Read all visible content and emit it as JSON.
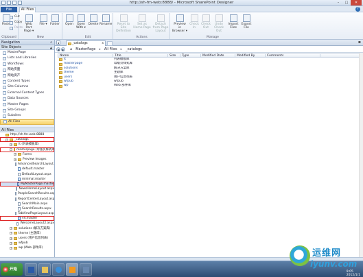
{
  "window": {
    "title": "http://sh-fm-web:8888/ - Microsoft SharePoint Designer",
    "controls": [
      "–",
      "□",
      "✕"
    ]
  },
  "menu": {
    "file": "File",
    "tab": "All Files",
    "help": "?"
  },
  "ribbon": {
    "clipboard": {
      "label": "Clipboard",
      "paste": "Paste",
      "cut": "Cut",
      "copy": "Copy",
      "paste_small": "Paste"
    },
    "new": {
      "label": "New",
      "web_part_page": "Web Part Page ▾",
      "file": "File ▾",
      "folder": "Folder"
    },
    "edit": {
      "label": "Edit",
      "open": "Open",
      "open_with": "Open With ▾",
      "delete": "Delete",
      "rename": "Rename"
    },
    "actions": {
      "label": "Actions",
      "reset": "Reset to Site Definition",
      "set_home": "Set as Home Page",
      "detach": "Detach from Page Layout"
    },
    "manage": {
      "label": "Manage",
      "preview": "Preview in Browser ▾",
      "check_in": "Check In",
      "check_out": "Check Out",
      "undo_checkout": "Undo Check Out",
      "import": "Import Files",
      "export": "Export File"
    }
  },
  "nav": {
    "title": "Navigation",
    "site_objects_header": "Site Objects",
    "site_objects": [
      "MasterPage",
      "Lists and Libraries",
      "Workflows",
      "网站页面",
      "网站资产",
      "Content Types",
      "Site Columns",
      "External Content Types",
      "Data Sources",
      "Master Pages",
      "Site Groups",
      "Subsites",
      "All Files"
    ],
    "all_files_header": "All Files",
    "tree": [
      {
        "label": "http://sh-fm-web:8888",
        "indent": 0,
        "type": "site",
        "exp": ""
      },
      {
        "label": "_catalogs",
        "indent": 1,
        "type": "folder",
        "exp": "−",
        "hl": true
      },
      {
        "label": "lt (列表模板库)",
        "indent": 2,
        "type": "folder",
        "exp": "+"
      },
      {
        "label": "masterpage (母版页样式库)",
        "indent": 2,
        "type": "folder",
        "exp": "−",
        "hl": true
      },
      {
        "label": "Forms",
        "indent": 3,
        "type": "folder",
        "exp": "+"
      },
      {
        "label": "Preview Images",
        "indent": 3,
        "type": "folder",
        "exp": "+"
      },
      {
        "label": "AdvancedSearchLayout.aspx",
        "indent": 3,
        "type": "page",
        "exp": ""
      },
      {
        "label": "default.master",
        "indent": 3,
        "type": "master",
        "exp": ""
      },
      {
        "label": "DefaultLayout.aspx",
        "indent": 3,
        "type": "page",
        "exp": ""
      },
      {
        "label": "minimal.master",
        "indent": 3,
        "type": "master",
        "exp": ""
      },
      {
        "label": "MyMasterPage.master",
        "indent": 3,
        "type": "master",
        "exp": "",
        "hl": true,
        "sel": true
      },
      {
        "label": "NewsHomeLayout.aspx",
        "indent": 3,
        "type": "page",
        "exp": ""
      },
      {
        "label": "PeopleSearchResults.aspx",
        "indent": 3,
        "type": "page",
        "exp": ""
      },
      {
        "label": "ReportCenterLayout.aspx",
        "indent": 3,
        "type": "page",
        "exp": ""
      },
      {
        "label": "SearchMain.aspx",
        "indent": 3,
        "type": "page",
        "exp": ""
      },
      {
        "label": "SearchResults.aspx",
        "indent": 3,
        "type": "page",
        "exp": ""
      },
      {
        "label": "TabViewPageLayout.aspx",
        "indent": 3,
        "type": "page",
        "exp": ""
      },
      {
        "label": "v4.master",
        "indent": 3,
        "type": "master",
        "exp": "",
        "hl": true
      },
      {
        "label": "WelcomeLayout2.aspx",
        "indent": 3,
        "type": "page",
        "exp": ""
      },
      {
        "label": "solutions (解决方案库)",
        "indent": 2,
        "type": "folder",
        "exp": "+"
      },
      {
        "label": "theme (主题库)",
        "indent": 2,
        "type": "folder",
        "exp": "+"
      },
      {
        "label": "users (用户信息列表)",
        "indent": 2,
        "type": "folder",
        "exp": "+"
      },
      {
        "label": "wfpub",
        "indent": 2,
        "type": "folder",
        "exp": "+"
      },
      {
        "label": "wp (Web 部件库)",
        "indent": 2,
        "type": "folder",
        "exp": "+"
      }
    ]
  },
  "tabs": {
    "doc_tab": "_catalogs",
    "close": "x"
  },
  "breadcrumb": {
    "items": [
      "MasterPage",
      "All Files",
      "_catalogs"
    ],
    "sep": "▸"
  },
  "grid": {
    "columns": [
      "Name",
      "Title",
      "Size",
      "Type",
      "Modified Date",
      "Modified By",
      "Comments"
    ],
    "rows": [
      {
        "name": "lt",
        "title": "列表模板库"
      },
      {
        "name": "masterpage",
        "title": "母版页样式库"
      },
      {
        "name": "solutions",
        "title": "解决方案库"
      },
      {
        "name": "theme",
        "title": "主题库"
      },
      {
        "name": "users",
        "title": "用户信息列表"
      },
      {
        "name": "wfpub",
        "title": "wfpub"
      },
      {
        "name": "wp",
        "title": "Web 部件库"
      }
    ]
  },
  "taskbar": {
    "start": "开始",
    "time": "9:05",
    "date": "2012/1/1"
  },
  "watermark": {
    "cn": "运维网",
    "url": "iyunv.com"
  }
}
